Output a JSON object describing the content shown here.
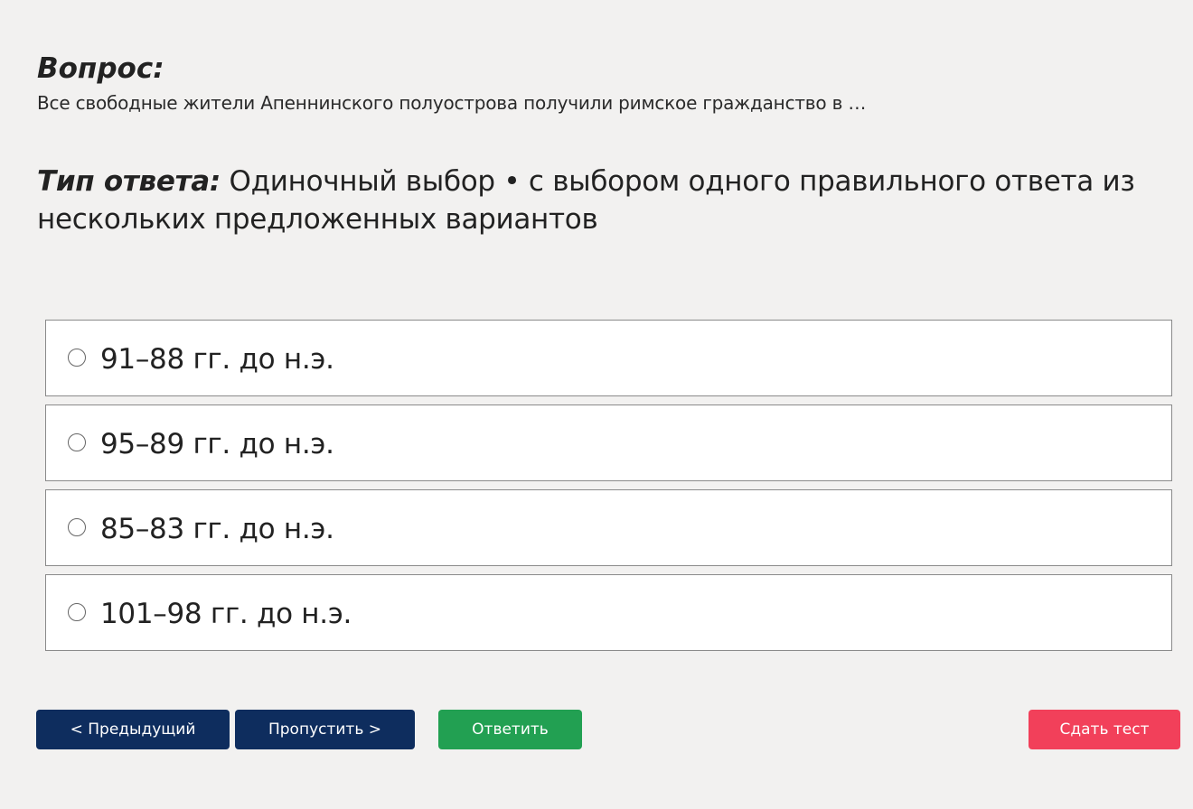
{
  "question": {
    "heading": "Вопрос:",
    "text": "Все свободные жители Апеннинского полуострова получили римское гражданство в …"
  },
  "answer_type": {
    "label": "Тип ответа:",
    "value": " Одиночный выбор • с выбором одного правильного ответа из нескольких предложенных вариантов"
  },
  "options": [
    {
      "label": "91–88 гг. до н.э."
    },
    {
      "label": "95–89 гг. до н.э."
    },
    {
      "label": "85–83 гг. до н.э."
    },
    {
      "label": "101–98 гг. до н.э."
    }
  ],
  "buttons": {
    "prev": "< Предыдущий",
    "skip": "Пропустить >",
    "answer": "Ответить",
    "finish": "Сдать тест"
  },
  "colors": {
    "nav_button": "#0e2d5e",
    "answer_button": "#22a052",
    "finish_button": "#f2405a"
  }
}
